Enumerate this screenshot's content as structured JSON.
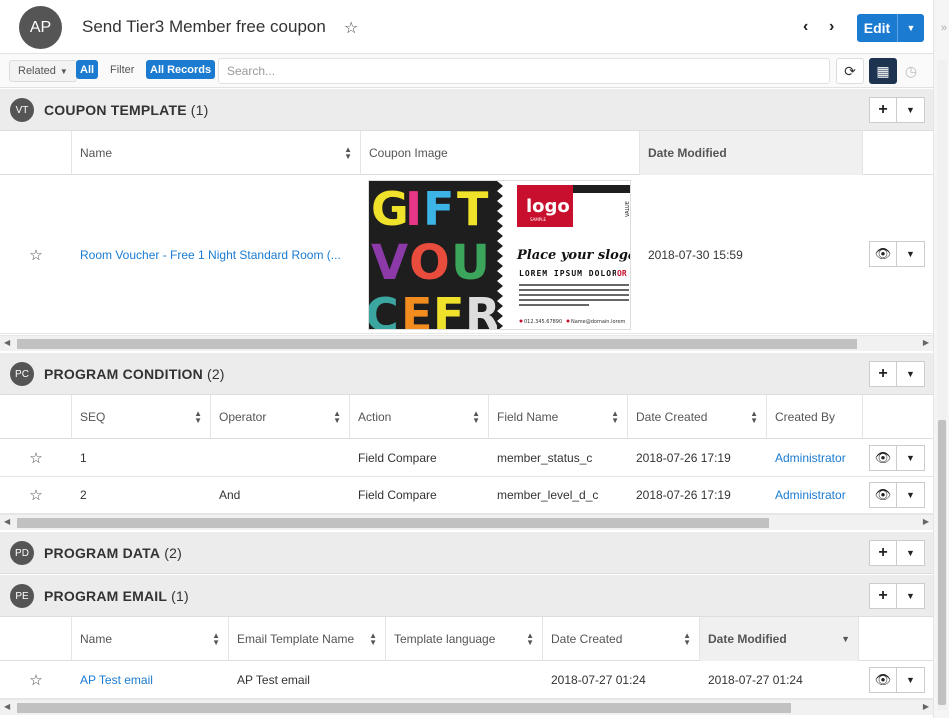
{
  "header": {
    "avatar": "AP",
    "title": "Send Tier3 Member free coupon",
    "edit_label": "Edit"
  },
  "filterbar": {
    "related_label": "Related",
    "related_all": "All",
    "filter_label": "Filter",
    "filter_value": "All Records",
    "search_placeholder": "Search..."
  },
  "coupon_template": {
    "badge": "VT",
    "title": "COUPON TEMPLATE",
    "count": "(1)",
    "columns": [
      "Name",
      "Coupon Image",
      "Date Modified"
    ],
    "rows": [
      {
        "name": "Room Voucher - Free 1 Night Standard Room (...",
        "date_modified": "2018-07-30 15:59"
      }
    ],
    "image": {
      "logo": "logo",
      "logo_sub": "SAMPLE",
      "value_label": "VALUE",
      "slogan": "Place your slogan",
      "lorem": "LOREM IPSUM DOLOR",
      "body": "Lorem ipsum dolor sit amet, consectetur adipiscing elit. Duis fringilla congue nisl eu feugiat tempus. Duis ultricies cursus luctus. Sed scelerisque luctus lectus.",
      "phone": "012.345.67890",
      "email": "Name@domain.lorem",
      "letters": [
        "G",
        "I",
        "F",
        "T",
        "V",
        "O",
        "U",
        "C",
        "H",
        "E",
        "R"
      ]
    }
  },
  "program_condition": {
    "badge": "PC",
    "title": "PROGRAM CONDITION",
    "count": "(2)",
    "columns": [
      "SEQ",
      "Operator",
      "Action",
      "Field Name",
      "Date Created",
      "Created By"
    ],
    "rows": [
      {
        "seq": "1",
        "operator": "",
        "action": "Field Compare",
        "field": "member_status_c",
        "date": "2018-07-26 17:19",
        "by": "Administrator"
      },
      {
        "seq": "2",
        "operator": "And",
        "action": "Field Compare",
        "field": "member_level_d_c",
        "date": "2018-07-26 17:19",
        "by": "Administrator"
      }
    ]
  },
  "program_data": {
    "badge": "PD",
    "title": "PROGRAM DATA",
    "count": "(2)"
  },
  "program_email": {
    "badge": "PE",
    "title": "PROGRAM EMAIL",
    "count": "(1)",
    "columns": [
      "Name",
      "Email Template Name",
      "Template language",
      "Date Created",
      "Date Modified"
    ],
    "rows": [
      {
        "name": "AP Test email",
        "template": "AP Test email",
        "language": "",
        "created": "2018-07-27 01:24",
        "modified": "2018-07-27 01:24"
      }
    ]
  },
  "colors": {
    "accent": "#1a7bd1",
    "header_bg": "#ececec",
    "active_icon": "#1e3350"
  }
}
